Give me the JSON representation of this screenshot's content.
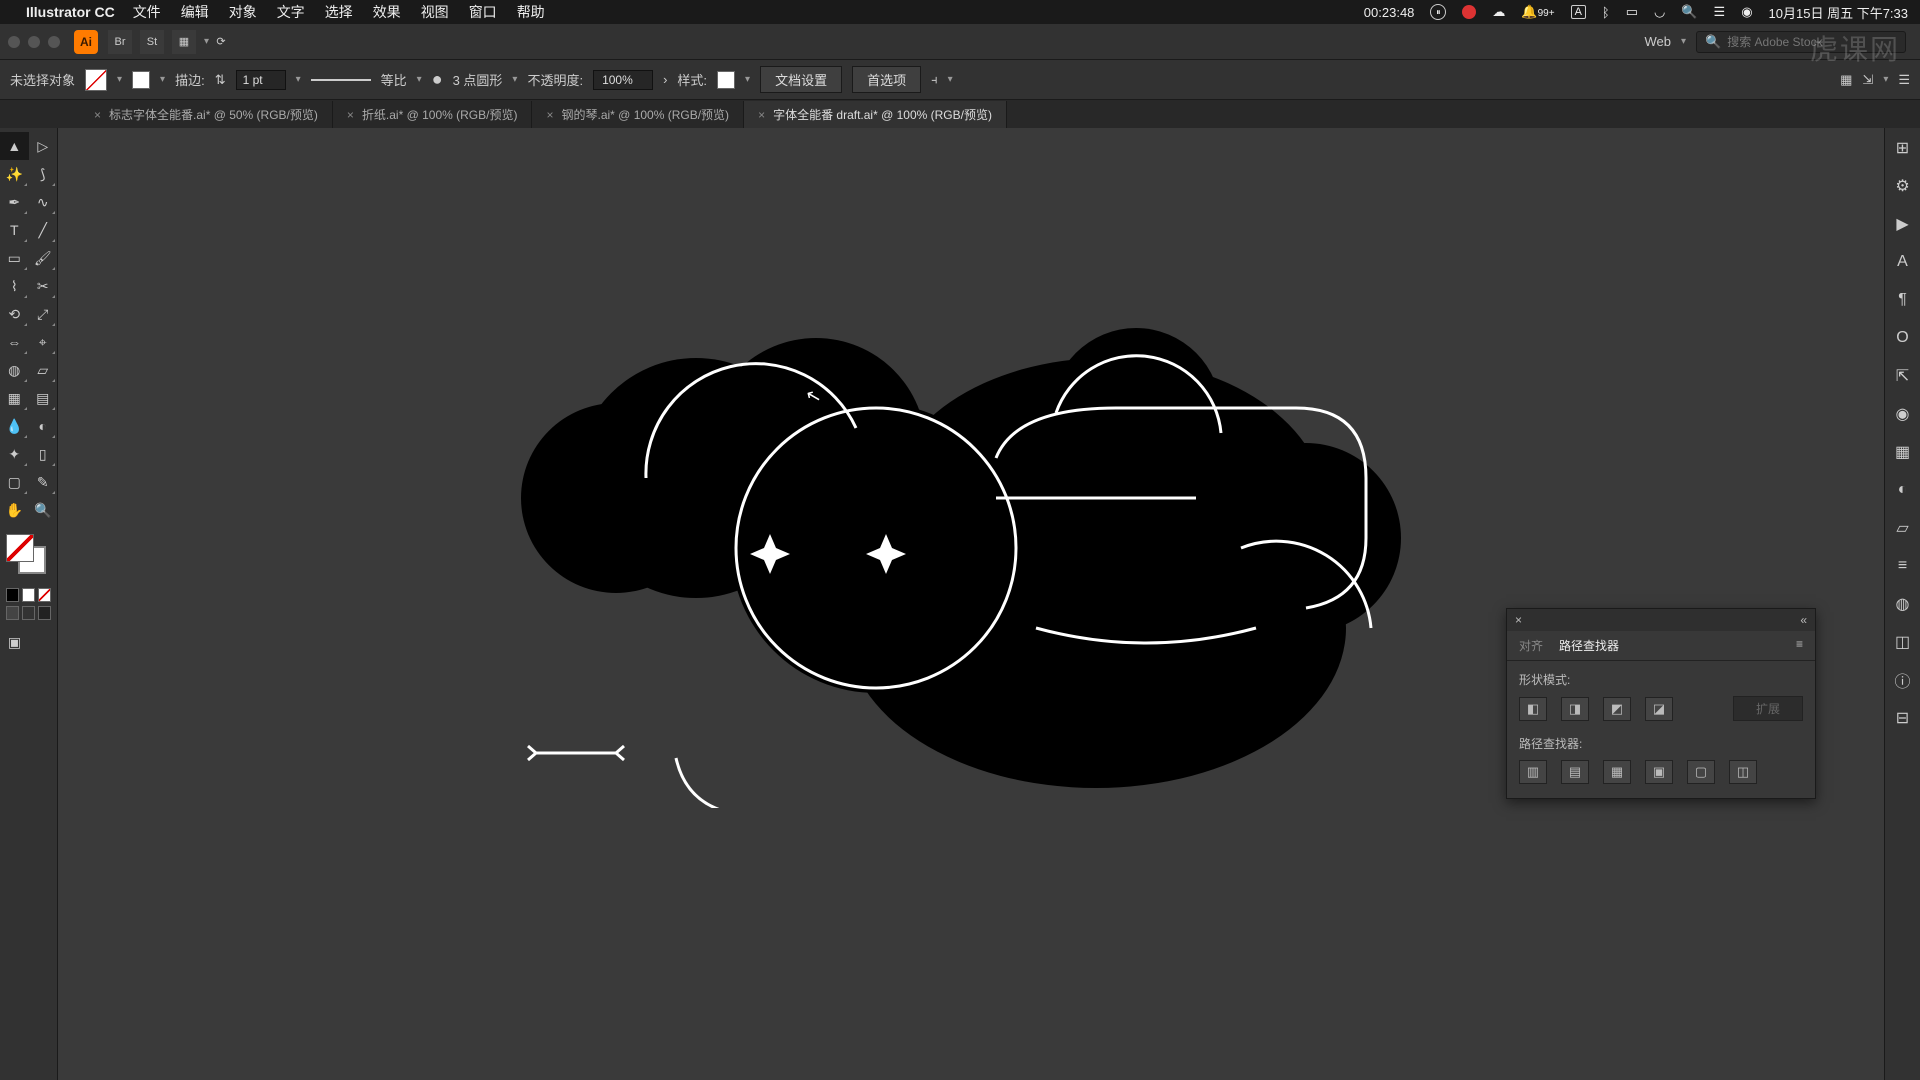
{
  "menubar": {
    "app": "Illustrator CC",
    "items": [
      "文件",
      "编辑",
      "对象",
      "文字",
      "选择",
      "效果",
      "视图",
      "窗口",
      "帮助"
    ],
    "timer": "00:23:48",
    "notif": "99+",
    "input_mode": "A",
    "date": "10月15日 周五 下午7:33"
  },
  "watermark": "虎课网",
  "appbar": {
    "doc_mode": "Web",
    "search_placeholder": "搜索 Adobe Stock"
  },
  "control": {
    "selection": "未选择对象",
    "stroke_label": "描边:",
    "stroke_weight": "1 pt",
    "profile": "等比",
    "brush": "3 点圆形",
    "opacity_label": "不透明度:",
    "opacity": "100%",
    "style_label": "样式:",
    "doc_setup": "文档设置",
    "prefs": "首选项"
  },
  "tabs": [
    {
      "label": "标志字体全能番.ai* @ 50% (RGB/预览)",
      "active": false
    },
    {
      "label": "折纸.ai* @ 100% (RGB/预览)",
      "active": false
    },
    {
      "label": "钢的琴.ai* @ 100% (RGB/预览)",
      "active": false
    },
    {
      "label": "字体全能番 draft.ai* @ 100% (RGB/预览)",
      "active": true
    }
  ],
  "pathfinder": {
    "tab_align": "对齐",
    "tab_pf": "路径查找器",
    "shape_modes": "形状模式:",
    "pf_label": "路径查找器:",
    "expand": "扩展"
  }
}
